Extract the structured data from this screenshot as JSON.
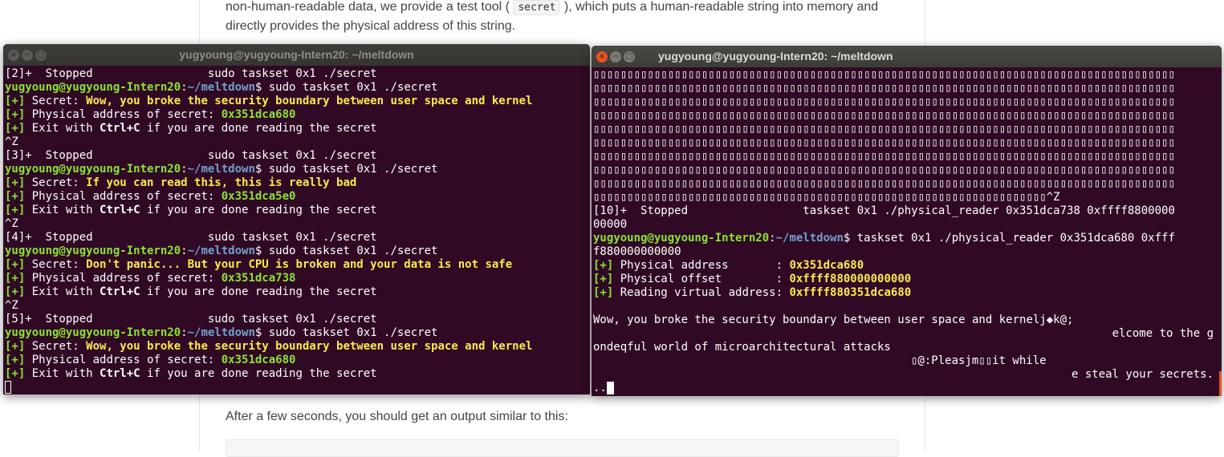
{
  "doc": {
    "para_part1": "non-human-readable data, we provide a test tool (",
    "code": "secret",
    "para_part2": "), which puts a human-readable string into memory and",
    "para_line2": "directly provides the physical address of this string.",
    "after_text": "After a few seconds, you should get an output similar to this:"
  },
  "left_term": {
    "title": "yugyoung@yugyoung-Intern20: ~/meltdown",
    "prompt_user": "yugyoung@yugyoung-Intern20",
    "prompt_colon": ":",
    "prompt_path": "~/meltdown",
    "prompt_dollar": "$ ",
    "command": "sudo taskset 0x1 ./secret",
    "plus": "[+]",
    "secret_label": " Secret: ",
    "addr_label": " Physical address of secret: ",
    "exit_pre": " Exit with ",
    "exit_key": "Ctrl+C",
    "exit_post": " if you are done reading the secret",
    "ctrl_z": "^Z",
    "stopped_2": "[2]+  Stopped                 sudo taskset 0x1 ./secret",
    "stopped_3": "[3]+  Stopped                 sudo taskset 0x1 ./secret",
    "stopped_4": "[4]+  Stopped                 sudo taskset 0x1 ./secret",
    "stopped_5": "[5]+  Stopped                 sudo taskset 0x1 ./secret",
    "runs": [
      {
        "secret": "Wow, you broke the security boundary between user space and kernel",
        "addr": "0x351dca680"
      },
      {
        "secret": "If you can read this, this is really bad",
        "addr": "0x351dca5e0"
      },
      {
        "secret": "Don't panic... But your CPU is broken and your data is not safe",
        "addr": "0x351dca738"
      },
      {
        "secret": "Wow, you broke the security boundary between user space and kernel",
        "addr": "0x351dca680"
      }
    ]
  },
  "right_term": {
    "title": "yugyoung@yugyoung-Intern20: ~/meltdown",
    "garbage_tail": "^Z",
    "stopped_10a": "[10]+  Stopped                 taskset 0x1 ./physical_reader 0x351dca738 0xffff8800000",
    "stopped_10b": "00000",
    "prompt_user": "yugyoung@yugyoung-Intern20",
    "prompt_colon": ":",
    "prompt_path": "~/meltdown",
    "prompt_dollar": "$ ",
    "command_a": "taskset 0x1 ./physical_reader 0x351dca680 0xfff",
    "command_b": "f880000000000",
    "plus": "[+]",
    "phys_addr_label": " Physical address       : ",
    "phys_addr_value": "0x351dca680",
    "phys_off_label": " Physical offset        : ",
    "phys_off_value": "0xffff880000000000",
    "virt_label": " Reading virtual address: ",
    "virt_value": "0xffff880351dca680",
    "out1": "Wow, you broke the security boundary between user space and kernelj◆k@;",
    "out2": "elcome to the g",
    "out3": "ondeqful world of microarchitectural attacks",
    "out4": "▯@:Pleasjm▯▯it while",
    "out5": "e steal your secrets.",
    "out6": ".."
  },
  "colors": {
    "terminal_bg": "#300a24",
    "green": "#8ae234",
    "blue": "#729fcf",
    "yellow": "#fce94f"
  }
}
